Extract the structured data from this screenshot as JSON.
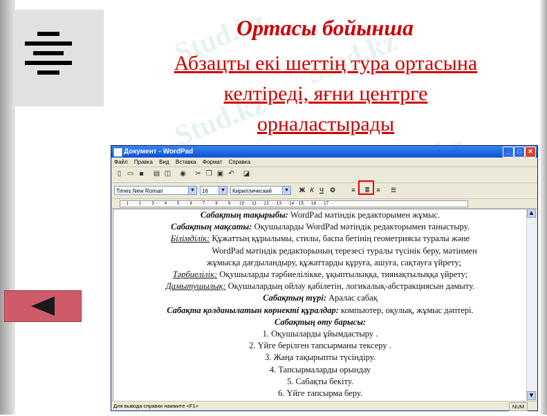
{
  "slide": {
    "title": "Ортасы бойынша",
    "subtitle_lines": [
      "Абзацты екі шеттің тура ортасына",
      "келтіреді, яғни центрге",
      "орналастырады"
    ],
    "watermark": "Stud.kz"
  },
  "window": {
    "title": "Документ - WordPad",
    "menu": [
      "Файл",
      "Правка",
      "Вид",
      "Вставка",
      "Формат",
      "Справка"
    ],
    "font_name": "Times New Roman",
    "font_size": "16",
    "charset": "Кириллический",
    "format_buttons": {
      "bold": "Ж",
      "italic": "К",
      "underline": "Ч"
    },
    "ruler": "· · 1 · · · 2 · · · 3 · · · 4 · · · 5 · · · 6 · · · 7 · · · 8 · · · 9 · · ·10· · ·11· · ·12· · ·13· · ·14· ·15· · ·16· · ·17· ·",
    "status": "Для вывода справки нажмите <F1>",
    "num_indicator": "NUM"
  },
  "document": {
    "l1_label": "Сабақтың тақырыбы:",
    "l1_text": " WordPad мәтіндік редакторымен жұмыс.",
    "l2_label": "Сабақтың мақсаты:",
    "l2_text": " Оқушыларды WordPad мәтіндік редакторымен таныстыру.",
    "l3_label": "Білімділік:",
    "l3_text": "  Құжаттың құрылымы, стилы, баспа бетінің геометриясы туралы және",
    "l4": "WordPad мәтіндік редакторының терезесі туралы түсінік беру, мәтінмен",
    "l5": "жұмысқа дағдыландыру, құжаттарды құруға, ашуға, сақтауға үйрету;",
    "l6_label": "Тәрбиелілік:",
    "l6_text": " Оқушыларды тәрбиелілікке, ұқыптылыққа, тиянақтылыққа үйрету;",
    "l7_label": "Дамытушылық:",
    "l7_text": " Оқушылардың ойлау қабілетін, логикалық-абстракциясын дамыту.",
    "l8_label": "Сабақтың түрі:",
    "l8_text": " Аралас сабақ",
    "l9_label": "Сабақта қолданылатын көрнекті құралдар:",
    "l9_text": " компьютер, оқулық, жұмыс дәптері.",
    "l10_label": "Сабақтың өту барысы:",
    "steps": [
      "1.  Оқушыларды ұйымдастыру .",
      "2.    Үйге берілген тапсырманы тексеру .",
      "3.  Жаңа тақырыпты түсіндіру.",
      "4.    Тапсырмаларды орындау",
      "5.    Сабақты бекіту.",
      "6.    Үйге тапсырма беру."
    ]
  },
  "colors": {
    "title": "#cc0000",
    "titlebar": "#0b50d6",
    "back_button": "#cf5a6a"
  },
  "icons": [
    "align-center-icon",
    "back-arrow-icon"
  ]
}
